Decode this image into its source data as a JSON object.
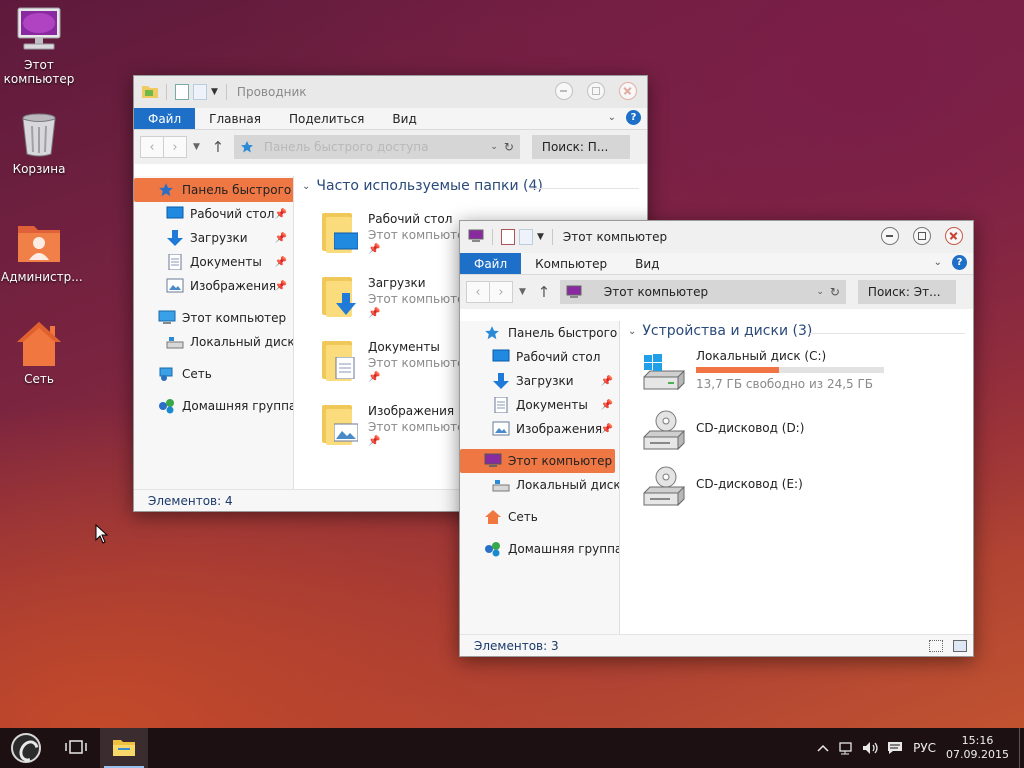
{
  "desktop": {
    "icons": [
      {
        "label": "Этот компьютер",
        "icon": "computer-icon"
      },
      {
        "label": "Корзина",
        "icon": "recycle-bin-icon"
      },
      {
        "label": "Администр...",
        "icon": "user-folder-icon"
      },
      {
        "label": "Сеть",
        "icon": "network-home-icon"
      }
    ]
  },
  "explorer_back": {
    "title": "Проводник",
    "ribbon": {
      "file": "Файл",
      "tabs": [
        "Главная",
        "Поделиться",
        "Вид"
      ]
    },
    "address": "Панель быстрого доступа",
    "search_placeholder": "Поиск: П...",
    "navpane": [
      {
        "label": "Панель быстрого до",
        "selected": true
      },
      {
        "label": "Рабочий стол",
        "pinned": true
      },
      {
        "label": "Загрузки",
        "pinned": true
      },
      {
        "label": "Документы",
        "pinned": true
      },
      {
        "label": "Изображения",
        "pinned": true
      },
      {
        "label": "Этот компьютер"
      },
      {
        "label": "Локальный диск (С"
      },
      {
        "label": "Сеть"
      },
      {
        "label": "Домашняя группа"
      }
    ],
    "group_title": "Часто используемые папки (4)",
    "folders": [
      {
        "name": "Рабочий стол",
        "sub": "Этот компьютер"
      },
      {
        "name": "Загрузки",
        "sub": "Этот компьютер"
      },
      {
        "name": "Документы",
        "sub": "Этот компьютер"
      },
      {
        "name": "Изображения",
        "sub": "Этот компьютер"
      }
    ],
    "status": "Элементов: 4"
  },
  "explorer_front": {
    "title": "Этот компьютер",
    "ribbon": {
      "file": "Файл",
      "tabs": [
        "Компьютер",
        "Вид"
      ]
    },
    "address": "Этот компьютер",
    "search_placeholder": "Поиск: Эт...",
    "navpane": [
      {
        "label": "Панель быстрого до"
      },
      {
        "label": "Рабочий стол"
      },
      {
        "label": "Загрузки",
        "pinned": true
      },
      {
        "label": "Документы",
        "pinned": true
      },
      {
        "label": "Изображения",
        "pinned": true
      },
      {
        "label": "Этот компьютер",
        "selected": true
      },
      {
        "label": "Локальный диск (С"
      },
      {
        "label": "Сеть"
      },
      {
        "label": "Домашняя группа"
      }
    ],
    "group_title": "Устройства и диски (3)",
    "drives": [
      {
        "name": "Локальный диск (C:)",
        "free": "13,7 ГБ свободно из 24,5 ГБ",
        "used_fraction": 0.44
      },
      {
        "name": "CD-дисковод (D:)"
      },
      {
        "name": "CD-дисковод (E:)"
      }
    ],
    "status": "Элементов: 3"
  },
  "taskbar": {
    "lang": "РУС",
    "time": "15:16",
    "date": "07.09.2015"
  },
  "colors": {
    "accent": "#1e6fc8",
    "selection": "#ef7744",
    "taskbar": "#1c1013"
  }
}
